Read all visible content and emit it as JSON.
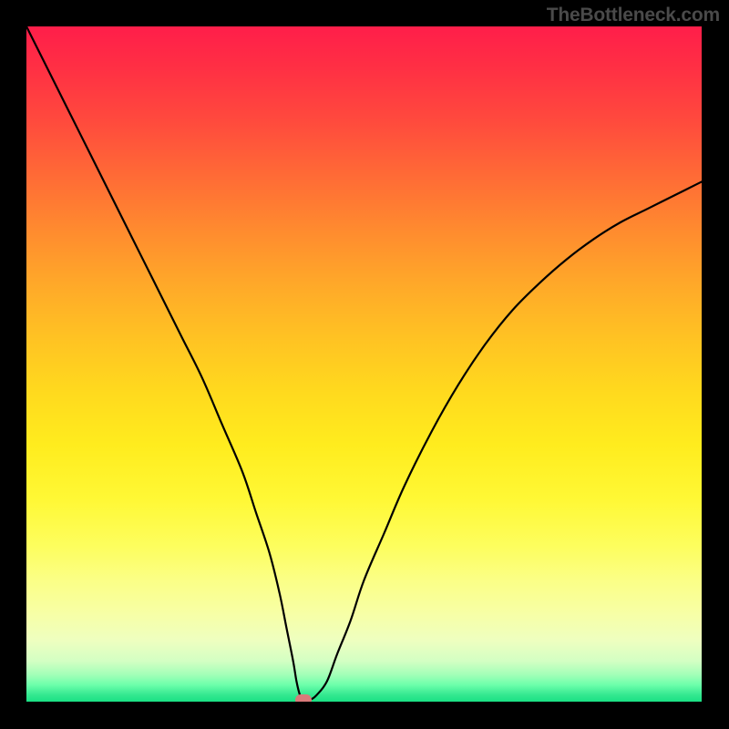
{
  "brand": "TheBottleneck.com",
  "chart_data": {
    "type": "line",
    "title": "",
    "xlabel": "",
    "ylabel": "",
    "xlim": [
      0,
      100
    ],
    "ylim": [
      0,
      100
    ],
    "grid": false,
    "background": "gradient-green-to-red",
    "series": [
      {
        "name": "bottleneck-curve",
        "x": [
          0,
          2,
          5,
          8,
          11,
          14,
          17,
          20,
          23,
          26,
          29,
          32,
          34,
          36,
          37.5,
          38.5,
          39.5,
          40,
          40.5,
          41,
          42,
          43,
          44.5,
          46,
          48,
          50,
          53,
          56,
          60,
          64,
          68,
          72,
          76,
          80,
          84,
          88,
          92,
          96,
          100
        ],
        "y": [
          100,
          96,
          90,
          84,
          78,
          72,
          66,
          60,
          54,
          48,
          41,
          34,
          28,
          22,
          16,
          11,
          6,
          3,
          1,
          0.3,
          0.3,
          1,
          3,
          7,
          12,
          18,
          25,
          32,
          40,
          47,
          53,
          58,
          62,
          65.5,
          68.5,
          71,
          73,
          75,
          77
        ]
      }
    ],
    "marker": {
      "x": 41,
      "y": 0.3,
      "color": "#d97a7a"
    }
  },
  "colors": {
    "curve": "#000000",
    "marker": "#d97a7a",
    "frame": "#000000"
  }
}
